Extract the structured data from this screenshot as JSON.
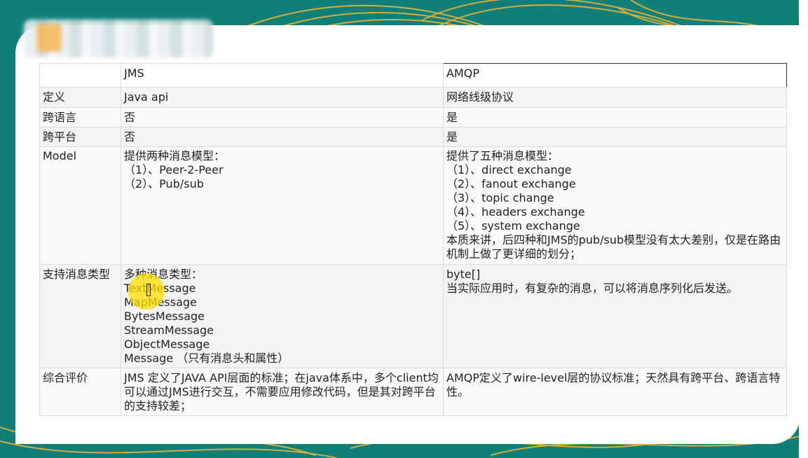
{
  "colors": {
    "background_teal": "#0f7f78",
    "swirl_gold": "#e9b23a",
    "highlight_yellow": "#ffde00"
  },
  "table": {
    "header": [
      "",
      "JMS",
      "AMQP"
    ],
    "rows": [
      {
        "label": "定义",
        "jms": "Java api",
        "amqp": "网络线级协议"
      },
      {
        "label": "跨语言",
        "jms": "否",
        "amqp": "是"
      },
      {
        "label": "跨平台",
        "jms": "否",
        "amqp": "是"
      },
      {
        "label": "Model",
        "jms": "提供两种消息模型：\n（1）、Peer-2-Peer\n（2）、Pub/sub",
        "amqp": "提供了五种消息模型：\n（1）、direct exchange\n（2）、fanout exchange\n（3）、topic change\n（4）、headers exchange\n（5）、system exchange\n本质来讲，后四种和JMS的pub/sub模型没有太大差别，仅是在路由机制上做了更详细的划分；"
      },
      {
        "label": "支持消息类型",
        "jms": "多种消息类型：\nTextMessage\nMapMessage\nBytesMessage\nStreamMessage\nObjectMessage\nMessage （只有消息头和属性）",
        "amqp": "byte[]\n当实际应用时，有复杂的消息，可以将消息序列化后发送。"
      },
      {
        "label": "综合评价",
        "jms": "JMS 定义了JAVA API层面的标准；在java体系中，多个client均可以通过JMS进行交互，不需要应用修改代码，但是其对跨平台的支持较差；",
        "amqp": "AMQP定义了wire-level层的协议标准；天然具有跨平台、跨语言特性。"
      }
    ]
  }
}
